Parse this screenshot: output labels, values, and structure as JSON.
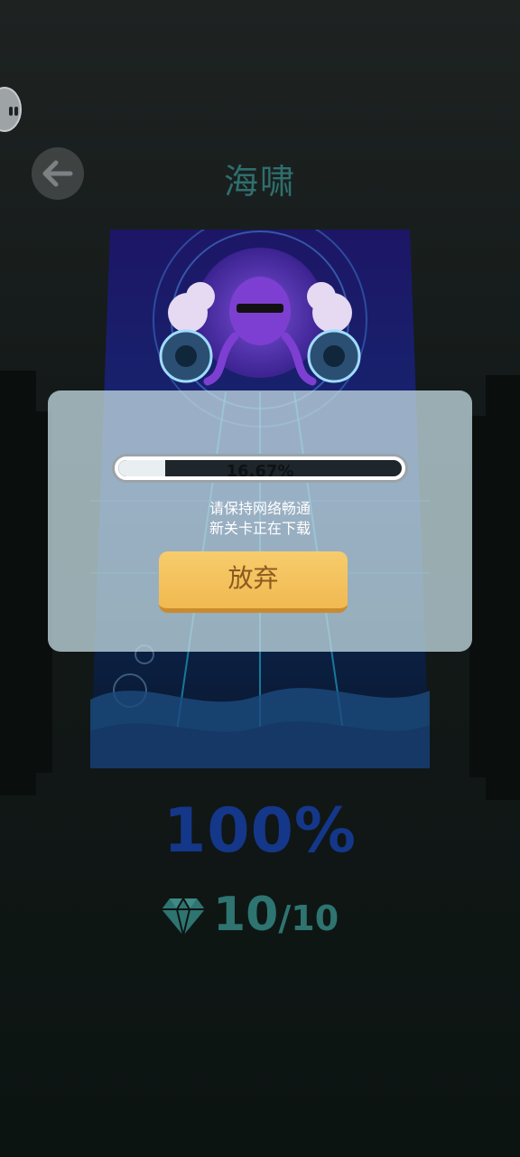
{
  "level": {
    "title": "海啸"
  },
  "download_dialog": {
    "progress_percent": 16.67,
    "progress_label": "16.67%",
    "message_line_1": "请保持网络畅通",
    "message_line_2": "新关卡正在下载",
    "abandon_label": "放弃"
  },
  "stats": {
    "completion": "100%",
    "gems_collected": "10",
    "gems_separator": "/",
    "gems_total": "10"
  },
  "icons": {
    "back": "arrow-left-icon",
    "gem": "diamond-icon",
    "assistant": "floating-bubble-icon"
  },
  "colors": {
    "title": "#2e6f6e",
    "completion": "#15378a",
    "gems": "#2e7471",
    "abandon_button": "#f1b951"
  }
}
